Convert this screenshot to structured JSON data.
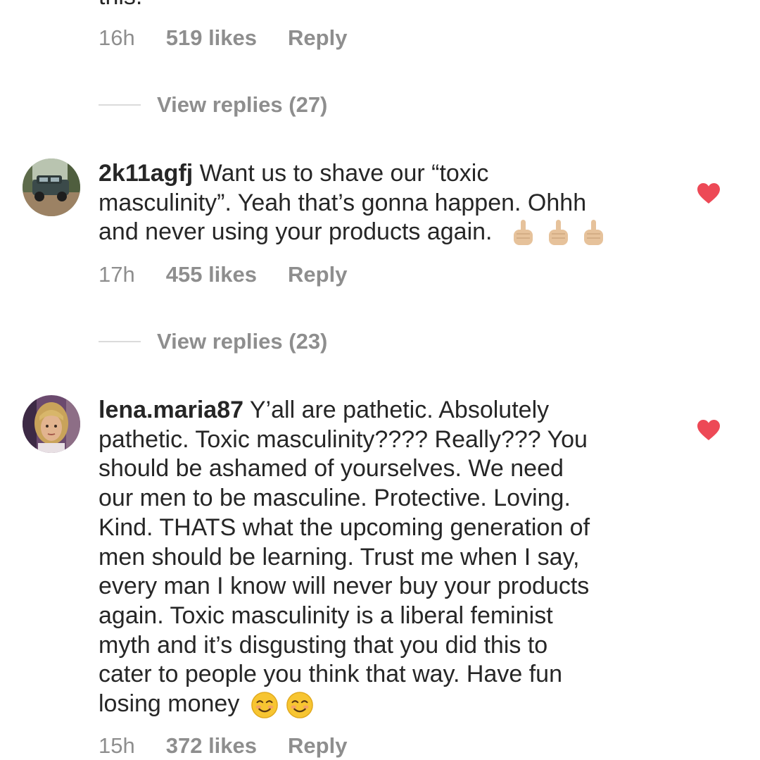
{
  "top_comment": {
    "cut_text": "this.",
    "time": "16h",
    "likes": "519 likes",
    "reply": "Reply",
    "view_replies": "View replies (27)"
  },
  "comment1": {
    "username": "2k11agfj",
    "lines": [
      "Want us to shave our “toxic",
      "masculinity”. Yeah that’s gonna happen.  Ohhh",
      "and never using your products again."
    ],
    "emoji": "middle-finger-emoji",
    "time": "17h",
    "likes": "455 likes",
    "reply": "Reply",
    "view_replies": "View replies (23)",
    "liked": true
  },
  "comment2": {
    "username": "lena.maria87",
    "lines": [
      "Y’all are pathetic. Absolutely",
      "pathetic. Toxic masculinity???? Really??? You",
      "should be ashamed of yourselves. We need",
      "our men to be masculine. Protective. Loving.",
      "Kind. THATS what the upcoming generation of",
      "men should be learning. Trust me when I say,",
      "every man I know will never buy your products",
      "again. Toxic masculinity is a liberal feminist",
      "myth and it’s disgusting that you did this to",
      "cater to people you think that way. Have fun",
      "losing money"
    ],
    "emoji": "smiling-face-emoji",
    "time": "15h",
    "likes": "372 likes",
    "reply": "Reply",
    "liked": true
  },
  "colors": {
    "text": "#262626",
    "secondary": "#8e8e8e",
    "heart": "#ed4956",
    "divider": "#dbdbdb"
  }
}
